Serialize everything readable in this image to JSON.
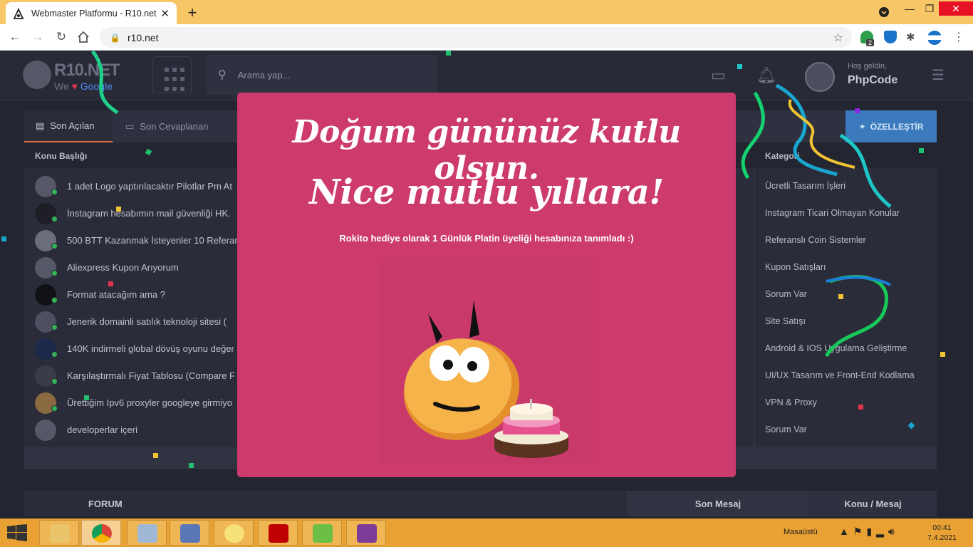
{
  "browser": {
    "tab_title": "Webmaster Platformu - R10.net",
    "new_tab": "+",
    "url": "r10.net",
    "ext_badge": "2"
  },
  "site": {
    "brand": "R10.NET",
    "tagline_we": "We",
    "tagline_google": "Google",
    "search_placeholder": "Arama yap...",
    "greeting": "Hoş geldin,",
    "username": "PhpCode"
  },
  "panel": {
    "tabs": [
      "Son Açılan",
      "Son Cevaplanan"
    ],
    "customize_label": "ÖZELLEŞTİR",
    "col_topic": "Konu Başlığı",
    "col_category": "Kategori",
    "topics": [
      "1 adet Logo yaptırılacaktır Pilotlar Pm At",
      "İnstagram hesabımın mail güvenliği HK.",
      "500 BTT Kazanmak İsteyenler 10 Referans",
      "Aliexpress Kupon Arıyorum",
      "Format atacağım ama ?",
      "Jenerik domainli satılık teknoloji sitesi (",
      "140K indirmeli global dövüş oyunu değer",
      "Karşılaştırmalı Fiyat Tablosu (Compare F",
      "Ürettiğim Ipv6 proxyler googleye girmiyo",
      "developerlar içeri"
    ],
    "categories": [
      "Ücretli Tasarım İşleri",
      "Instagram Ticari Olmayan Konular",
      "Referanslı Coin Sistemler",
      "Kupon Satışları",
      "Sorum Var",
      "Site Satışı",
      "Android & IOS Uygulama Geliştirme",
      "UI/UX Tasarım ve Front-End Kodlama",
      "VPN & Proxy",
      "Sorum Var"
    ]
  },
  "forum_bar": {
    "forum": "FORUM",
    "last_message": "Son Mesaj",
    "topic_message": "Konu / Mesaj"
  },
  "modal": {
    "line1": "Doğum gününüz kutlu olsun.",
    "line2": "Nice mutlu yıllara!",
    "gift_text": "Rokito hediye olarak 1 Günlük Platin üyeliği hesabınıza tanımladı :)"
  },
  "taskbar": {
    "desktop_label": "Masaüstü",
    "time": "00:41",
    "date": "7.4.2021"
  },
  "colors": {
    "tab_bar": "#f6c667",
    "modal_bg": "#cc3a6e",
    "page_bg": "#232531",
    "accent_blue": "#3b7bbd",
    "online_green": "#33b355",
    "taskbar": "#e8a132"
  },
  "icons": [
    "r10-favicon",
    "back-icon",
    "forward-icon",
    "reload-icon",
    "home-icon",
    "lock-icon",
    "star-icon",
    "extensions-icon",
    "grid-menu-icon",
    "search-icon",
    "chat-icon",
    "bell-icon",
    "menu-settings-icon",
    "document-icon",
    "comment-icon",
    "wand-icon",
    "windows-start-icon",
    "chrome-icon",
    "explorer-icon",
    "filezilla-icon",
    "winrar-icon"
  ]
}
